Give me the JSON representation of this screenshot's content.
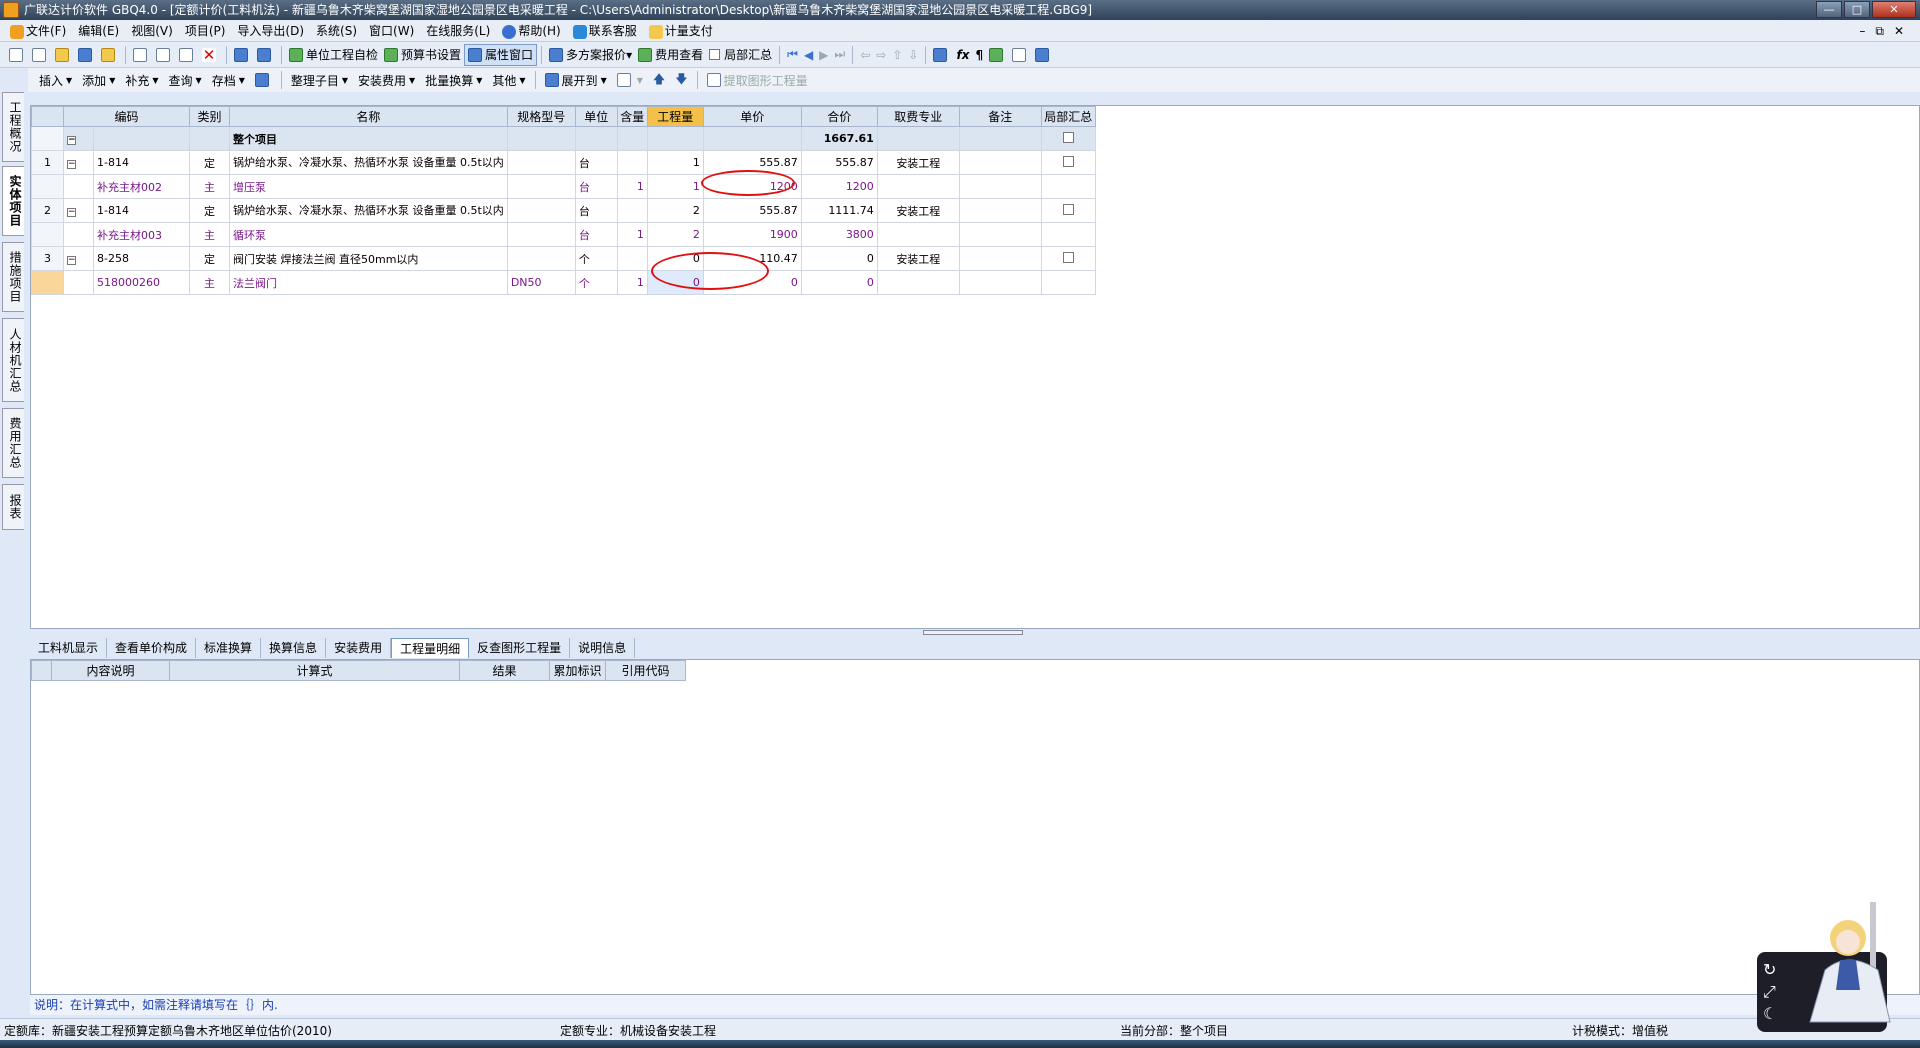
{
  "window": {
    "title": "广联达计价软件 GBQ4.0 - [定额计价(工料机法) - 新疆乌鲁木齐柴窝堡湖国家湿地公园景区电采暖工程 - C:\\Users\\Administrator\\Desktop\\新疆乌鲁木齐柴窝堡湖国家湿地公园景区电采暖工程.GBG9]",
    "controls": [
      "—",
      "□",
      "✕"
    ]
  },
  "menu": [
    "文件(F)",
    "编辑(E)",
    "视图(V)",
    "项目(P)",
    "导入导出(D)",
    "系统(S)",
    "窗口(W)",
    "在线服务(L)",
    "帮助(H)",
    "联系客服",
    "计量支付"
  ],
  "mdi_controls": "–⧉✕",
  "toolbar1": {
    "self_check": "单位工程自检",
    "budget_settings": "预算书设置",
    "property_window": "属性窗口",
    "multi_quote": "多方案报价",
    "fee_view": "费用查看",
    "partial_summary": "局部汇总"
  },
  "toolbar2": [
    "插入",
    "添加",
    "补充",
    "查询",
    "存档",
    "整理子目",
    "安装费用",
    "批量换算",
    "其他",
    "展开到",
    "提取图形工程量"
  ],
  "vtabs": [
    "工程概况",
    "实体项目",
    "措施项目",
    "人材机汇总",
    "费用汇总",
    "报表"
  ],
  "grid": {
    "columns": [
      "编码",
      "类别",
      "名称",
      "规格型号",
      "单位",
      "含量",
      "工程量",
      "单价",
      "合价",
      "取费专业",
      "备注",
      "局部汇总"
    ],
    "summary": {
      "name": "整个项目",
      "total": "1667.61"
    },
    "rows": [
      {
        "no": "1",
        "code": "1-814",
        "type": "定",
        "name": "锅炉给水泵、冷凝水泵、热循环水泵 设备重量 0.5t以内",
        "spec": "",
        "unit": "台",
        "content": "",
        "qty": "1",
        "price": "555.87",
        "total": "555.87",
        "fee": "安装工程"
      },
      {
        "no": "",
        "code": "补充主材002",
        "type": "主",
        "name": "增压泵",
        "spec": "",
        "unit": "台",
        "content": "1",
        "qty": "1",
        "price": "1200",
        "total": "1200",
        "fee": ""
      },
      {
        "no": "2",
        "code": "1-814",
        "type": "定",
        "name": "锅炉给水泵、冷凝水泵、热循环水泵 设备重量 0.5t以内",
        "spec": "",
        "unit": "台",
        "content": "",
        "qty": "2",
        "price": "555.87",
        "total": "1111.74",
        "fee": "安装工程"
      },
      {
        "no": "",
        "code": "补充主材003",
        "type": "主",
        "name": "循环泵",
        "spec": "",
        "unit": "台",
        "content": "1",
        "qty": "2",
        "price": "1900",
        "total": "3800",
        "fee": ""
      },
      {
        "no": "3",
        "code": "8-258",
        "type": "定",
        "name": "阀门安装 焊接法兰阀 直径50mm以内",
        "spec": "",
        "unit": "个",
        "content": "",
        "qty": "0",
        "price": "110.47",
        "total": "0",
        "fee": "安装工程"
      },
      {
        "no": "",
        "code": "518000260",
        "type": "主",
        "name": "法兰阀门",
        "spec": "DN50",
        "unit": "个",
        "content": "1",
        "qty": "0",
        "price": "0",
        "total": "0",
        "fee": ""
      }
    ]
  },
  "bottom_tabs": [
    "工料机显示",
    "查看单价构成",
    "标准换算",
    "换算信息",
    "安装费用",
    "工程量明细",
    "反查图形工程量",
    "说明信息"
  ],
  "detail_columns": [
    "内容说明",
    "计算式",
    "结果",
    "累加标识",
    "引用代码"
  ],
  "note": "说明：在计算式中，如需注释请填写在｛｝内.",
  "status": {
    "quota_lib": "定额库：新疆安装工程预算定额乌鲁木齐地区单位估价(2010)",
    "quota_major": "定额专业：机械设备安装工程",
    "current_part": "当前分部：整个项目",
    "tax_mode": "计税模式：增值税"
  },
  "colors": {
    "accent": "#f5c04a",
    "material_text": "#7a168a",
    "annotation": "#e01010"
  }
}
